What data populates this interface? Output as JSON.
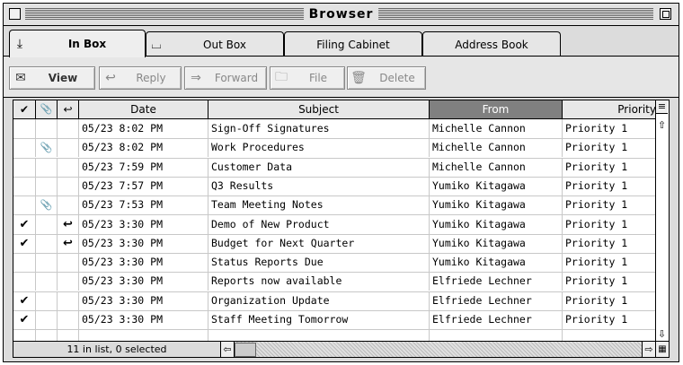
{
  "window": {
    "title": "Browser"
  },
  "tabs": [
    {
      "label": "In Box",
      "icon": "inbox-download-icon",
      "active": true
    },
    {
      "label": "Out Box",
      "icon": "outbox-tray-icon",
      "active": false
    },
    {
      "label": "Filing Cabinet",
      "active": false
    },
    {
      "label": "Address Book",
      "active": false
    }
  ],
  "toolbar": {
    "view_label": "View",
    "reply_label": "Reply",
    "forward_label": "Forward",
    "file_label": "File",
    "delete_label": "Delete"
  },
  "table": {
    "columns": {
      "read": "✔",
      "attachment": "📎",
      "replied": "↩",
      "date": "Date",
      "subject": "Subject",
      "from": "From",
      "priority": "Priority"
    },
    "sorted_column": "From",
    "rows": [
      {
        "read": "",
        "attach": "",
        "replied": "",
        "date": "05/23  8:02 PM",
        "subject": "Sign-Off Signatures",
        "from": "Michelle Cannon",
        "priority": "Priority 1"
      },
      {
        "read": "",
        "attach": "📎",
        "replied": "",
        "date": "05/23  8:02 PM",
        "subject": "Work Procedures",
        "from": "Michelle Cannon",
        "priority": "Priority 1"
      },
      {
        "read": "",
        "attach": "",
        "replied": "",
        "date": "05/23  7:59 PM",
        "subject": "Customer Data",
        "from": "Michelle Cannon",
        "priority": "Priority 1"
      },
      {
        "read": "",
        "attach": "",
        "replied": "",
        "date": "05/23  7:57 PM",
        "subject": "Q3 Results",
        "from": "Yumiko Kitagawa",
        "priority": "Priority 1"
      },
      {
        "read": "",
        "attach": "📎",
        "replied": "",
        "date": "05/23  7:53 PM",
        "subject": "Team Meeting Notes",
        "from": "Yumiko Kitagawa",
        "priority": "Priority 1"
      },
      {
        "read": "✔",
        "attach": "",
        "replied": "↩",
        "date": "05/23  3:30 PM",
        "subject": "Demo of New Product",
        "from": "Yumiko Kitagawa",
        "priority": "Priority 1"
      },
      {
        "read": "✔",
        "attach": "",
        "replied": "↩",
        "date": "05/23  3:30 PM",
        "subject": "Budget for Next Quarter",
        "from": "Yumiko Kitagawa",
        "priority": "Priority 1"
      },
      {
        "read": "",
        "attach": "",
        "replied": "",
        "date": "05/23  3:30 PM",
        "subject": "Status Reports Due",
        "from": "Yumiko Kitagawa",
        "priority": "Priority 1"
      },
      {
        "read": "",
        "attach": "",
        "replied": "",
        "date": "05/23  3:30 PM",
        "subject": "Reports now available",
        "from": "Elfriede Lechner",
        "priority": "Priority 1"
      },
      {
        "read": "✔",
        "attach": "",
        "replied": "",
        "date": "05/23  3:30 PM",
        "subject": "Organization Update",
        "from": "Elfriede Lechner",
        "priority": "Priority 1"
      },
      {
        "read": "✔",
        "attach": "",
        "replied": "",
        "date": "05/23  3:30 PM",
        "subject": "Staff Meeting Tomorrow",
        "from": "Elfriede Lechner",
        "priority": "Priority 1"
      }
    ]
  },
  "status": {
    "text": "11 in list, 0 selected"
  }
}
